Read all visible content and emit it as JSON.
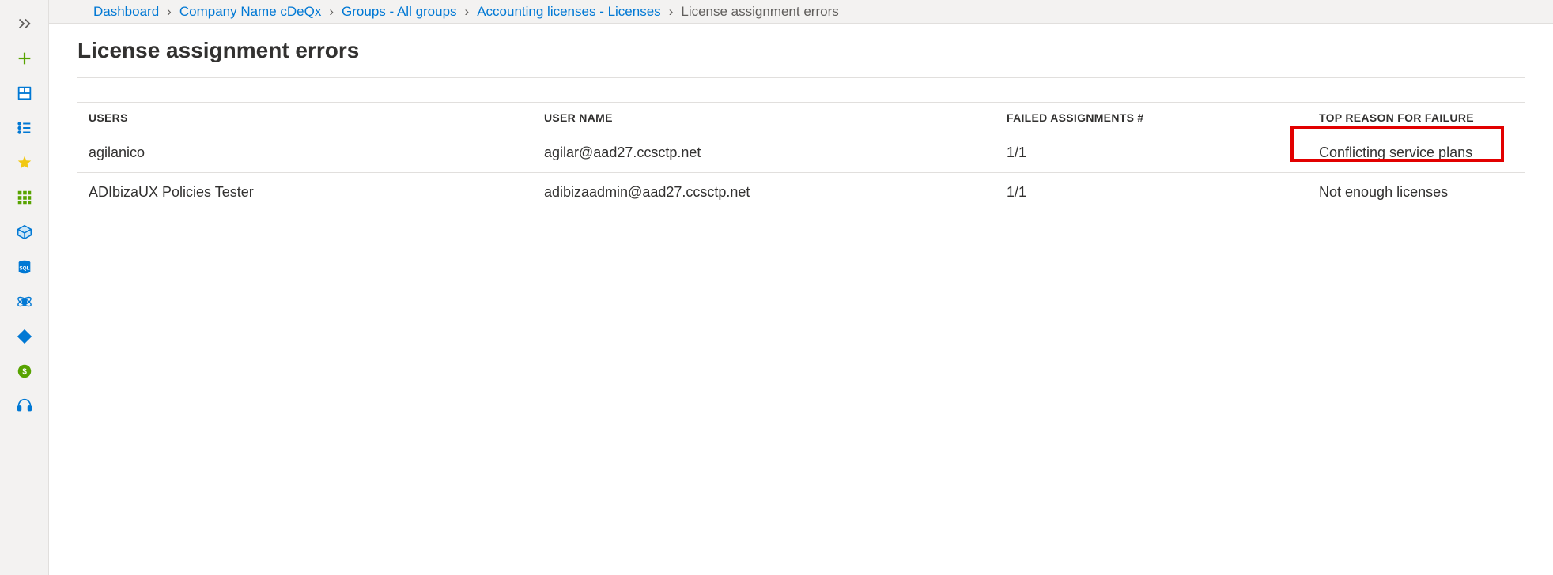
{
  "breadcrumb": {
    "items": [
      {
        "label": "Dashboard"
      },
      {
        "label": "Company Name cDeQx"
      },
      {
        "label": "Groups - All groups"
      },
      {
        "label": "Accounting licenses - Licenses"
      }
    ],
    "current": "License assignment errors"
  },
  "page": {
    "title": "License assignment errors"
  },
  "table": {
    "headers": {
      "users": "Users",
      "user_name": "User Name",
      "failed": "Failed Assignments #",
      "reason": "Top Reason for Failure"
    },
    "rows": [
      {
        "users": "agilanico",
        "user_name": "agilar@aad27.ccsctp.net",
        "failed": "1/1",
        "reason": "Conflicting service plans"
      },
      {
        "users": "ADIbizaUX Policies Tester",
        "user_name": "adibizaadmin@aad27.ccsctp.net",
        "failed": "1/1",
        "reason": "Not enough licenses"
      }
    ]
  },
  "navrail": {
    "icons": [
      "expand-icon",
      "add-icon",
      "dashboard-icon",
      "list-icon",
      "star-icon",
      "all-services-icon",
      "cube-icon",
      "sql-icon",
      "cosmos-icon",
      "devops-icon",
      "cost-icon",
      "support-icon"
    ]
  },
  "colors": {
    "link": "#0078d4",
    "highlight_border": "#e20000",
    "panel_bg": "#ffffff",
    "rail_bg": "#f3f2f1"
  }
}
